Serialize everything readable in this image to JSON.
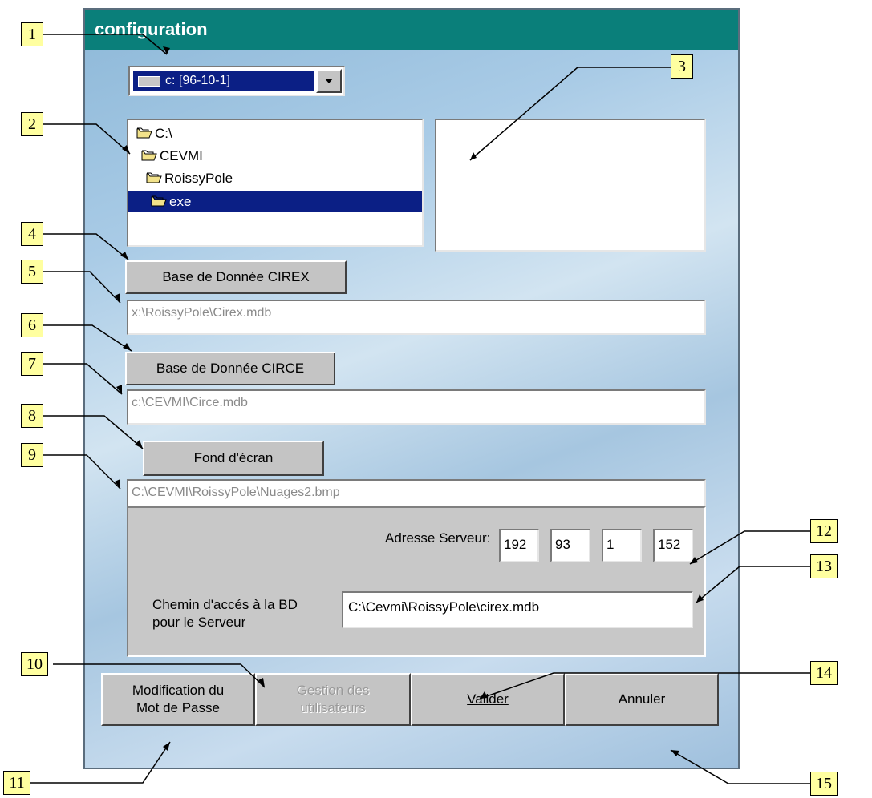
{
  "window": {
    "title": "configuration"
  },
  "drive": {
    "selected": "c: [96-10-1]"
  },
  "folders": [
    "C:\\",
    "CEVMI",
    "RoissyPole",
    "exe"
  ],
  "buttons": {
    "cirex": "Base de Donnée CIREX",
    "circe": "Base de Donnée CIRCE",
    "wallpaper": "Fond d'écran",
    "password_line1": "Modification du",
    "password_line2": "Mot de Passe",
    "users_line1": "Gestion des",
    "users_line2": "utilisateurs",
    "validate": "Valider",
    "cancel": "Annuler"
  },
  "fields": {
    "cirex_path": "x:\\RoissyPole\\Cirex.mdb",
    "circe_path": "c:\\CEVMI\\Circe.mdb",
    "wallpaper_path": "C:\\CEVMI\\RoissyPole\\Nuages2.bmp"
  },
  "server": {
    "address_label": "Adresse Serveur:",
    "ip": [
      "192",
      "93",
      "1",
      "152"
    ],
    "db_path_label_line1": "Chemin d'accés à la BD",
    "db_path_label_line2": "pour le Serveur",
    "db_path": "C:\\Cevmi\\RoissyPole\\cirex.mdb"
  },
  "callouts": [
    "1",
    "2",
    "3",
    "4",
    "5",
    "6",
    "7",
    "8",
    "9",
    "10",
    "11",
    "12",
    "13",
    "14",
    "15"
  ],
  "colors": {
    "titlebar": "#0a7f7a",
    "selection": "#0b1f85",
    "callout": "#ffffa0"
  }
}
